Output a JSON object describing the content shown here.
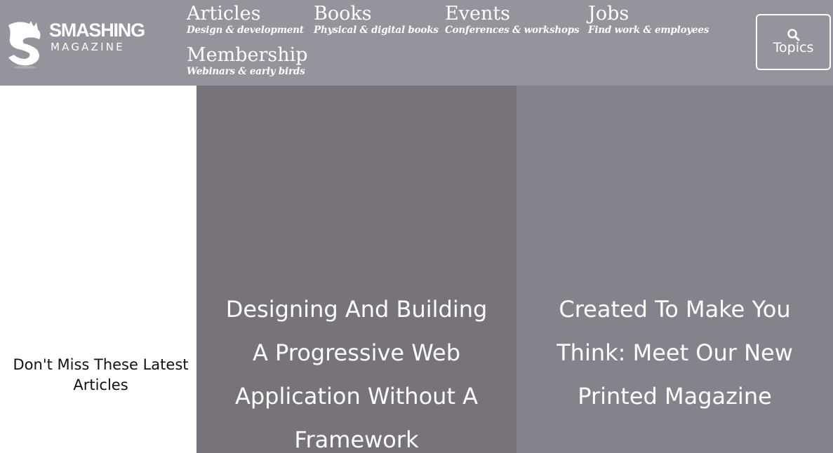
{
  "header": {
    "logo": {
      "word": "SMASHING",
      "sub": "MAGAZINE"
    },
    "nav": [
      {
        "title": "Articles",
        "sub": "Design & development"
      },
      {
        "title": "Books",
        "sub": "Physical & digital books"
      },
      {
        "title": "Events",
        "sub": "Conferences & workshops"
      },
      {
        "title": "Jobs",
        "sub": "Find work & employees"
      },
      {
        "title": "Membership",
        "sub": "Webinars & early birds"
      }
    ],
    "topics_button": {
      "label": "Topics",
      "icon": "search-icon"
    }
  },
  "main": {
    "latest_label": "Don't Miss These Latest Articles",
    "cards": [
      {
        "title": "Designing And Building A Progressive Web Application Without A Framework"
      },
      {
        "title": "Created To Make You Think: Meet Our New Printed Magazine"
      }
    ]
  },
  "colors": {
    "header_bg": "#97939c",
    "card_1_bg": "#78737a",
    "card_2_bg": "#86828b",
    "text_on_dark": "#ffffff",
    "text_on_light": "#111111"
  }
}
